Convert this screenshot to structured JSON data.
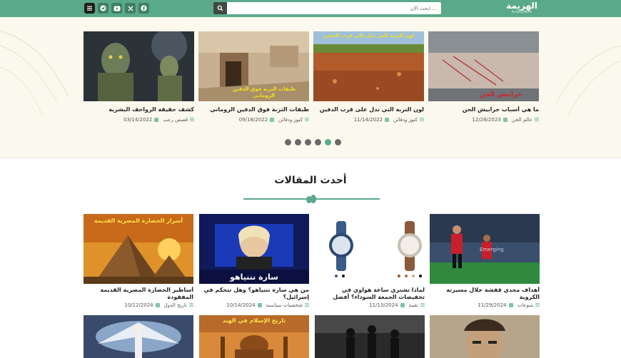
{
  "header": {
    "logo_text": "الهزيمة",
    "logo_sub": "ALHAZIMAH",
    "search_placeholder": "ابحث الان ...",
    "social": [
      "menu-icon",
      "telegram-icon",
      "youtube-icon",
      "x-icon",
      "facebook-icon"
    ]
  },
  "slider": {
    "cards": [
      {
        "title": "ما هي أسباب خرابيش الجن",
        "category": "عالم الجن",
        "date": "12/28/2023",
        "overlay": "خرابيش الجن"
      },
      {
        "title": "لون التربة التي تدل على قرب الدفين",
        "category": "كنوز ودفائن",
        "date": "11/14/2022",
        "overlay": "لون التربة التي تدل على قرب الدفين"
      },
      {
        "title": "طبقات التربة فوق الدفين الروماني",
        "category": "كنوز ودفائن",
        "date": "09/18/2022",
        "overlay": "طبقات التربة فوق الدفين الروماني"
      },
      {
        "title": "كشف حقيقة الزواحف البشرية",
        "category": "قصص رعب",
        "date": "03/14/2022",
        "overlay": ""
      }
    ],
    "dots_count": 6,
    "active_dot": 4
  },
  "latest": {
    "title": "أحدث المقالات",
    "cards": [
      {
        "title": "أهداف مجدي قفشة خلال مسيرته الكروية",
        "category": "منوعات",
        "date": "11/29/2024",
        "overlay": ""
      },
      {
        "title": "لماذا تشتري ساعة هواوي في تخفيضات الجمعة السوداء؟ أفضل العروض والمزايا",
        "category": "تقنية",
        "date": "11/13/2024",
        "overlay": ""
      },
      {
        "title": "من هي سارة نتنياهو؟ وهل تتحكم في إسرائيل؟",
        "category": "شخصيات سياسية",
        "date": "10/14/2024",
        "overlay": "سارة نتنياهو"
      },
      {
        "title": "أساطير الحضارة المصرية القديمة المفقودة",
        "category": "تاريخ الدول",
        "date": "10/12/2024",
        "overlay": "أسرار الحضارة المصرية القديمة"
      }
    ],
    "bottom_overlays": [
      "",
      "",
      "تاريخ الإسلام في الهند",
      ""
    ]
  },
  "colors": {
    "accent": "#5aa98a",
    "cream": "#fbf9ee"
  }
}
